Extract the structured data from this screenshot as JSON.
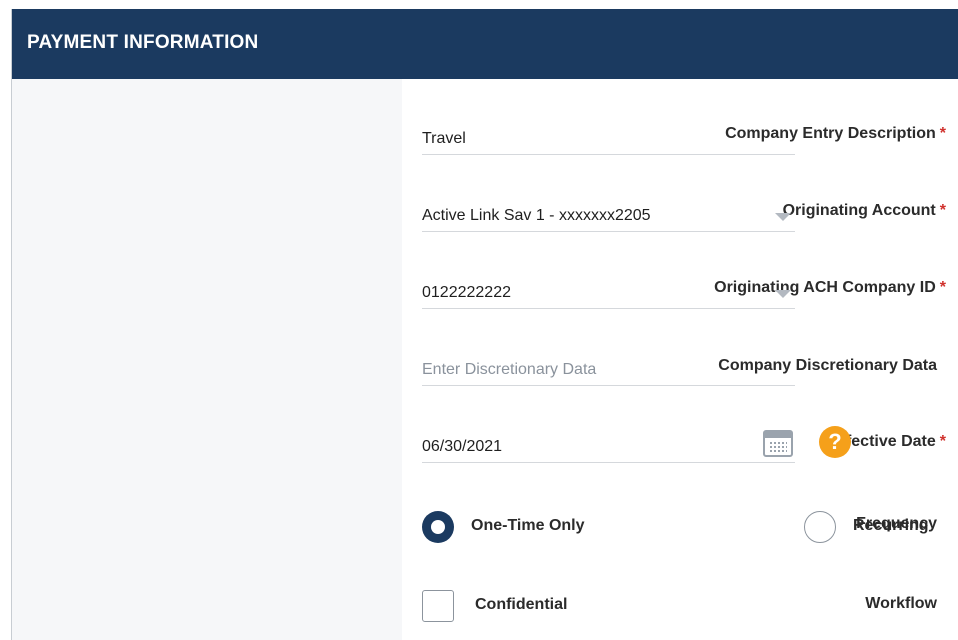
{
  "header": {
    "title": "PAYMENT INFORMATION"
  },
  "required_marker": "*",
  "fields": {
    "company_entry_description": {
      "label": "Company Entry Description",
      "value": "Travel"
    },
    "originating_account": {
      "label": "Originating Account",
      "value": "Active Link Sav 1 - xxxxxxx2205"
    },
    "originating_ach_company_id": {
      "label": "Originating ACH Company ID",
      "value": "0122222222"
    },
    "company_discretionary_data": {
      "label": "Company Discretionary Data",
      "placeholder": "Enter Discretionary Data"
    },
    "effective_date": {
      "label": "Effective Date",
      "value": "06/30/2021",
      "help_glyph": "?"
    }
  },
  "frequency": {
    "label": "Frequency",
    "options": [
      "One-Time Only",
      "Recurring"
    ],
    "selected": "One-Time Only"
  },
  "workflow": {
    "label": "Workflow",
    "option": "Confidential",
    "checked": false
  },
  "colors": {
    "header_bg": "#1b3a60",
    "required": "#d0312d",
    "help": "#f5a01a"
  }
}
